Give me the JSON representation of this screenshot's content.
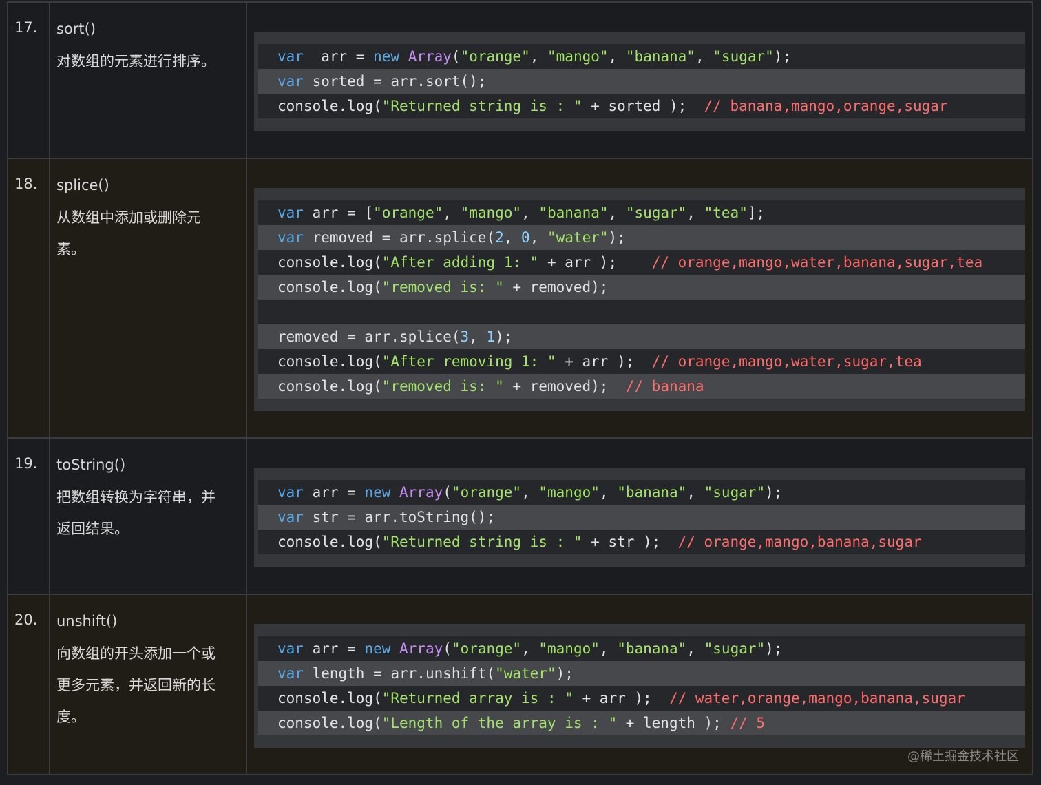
{
  "rows": [
    {
      "num": "17.",
      "method": "sort()",
      "desc": [
        "对数组的元素进行排序。"
      ],
      "code": [
        {
          "style": "dark",
          "tokens": [
            [
              "kw",
              "var"
            ],
            [
              "",
              "  arr = "
            ],
            [
              "kw",
              "new"
            ],
            [
              "",
              " "
            ],
            [
              "cls",
              "Array"
            ],
            [
              "",
              "("
            ],
            [
              "str",
              "\"orange\""
            ],
            [
              "",
              ", "
            ],
            [
              "str",
              "\"mango\""
            ],
            [
              "",
              ", "
            ],
            [
              "str",
              "\"banana\""
            ],
            [
              "",
              ", "
            ],
            [
              "str",
              "\"sugar\""
            ],
            [
              "",
              ");"
            ]
          ]
        },
        {
          "style": "alt",
          "tokens": [
            [
              "kw",
              "var"
            ],
            [
              "",
              " sorted = arr.sort();"
            ]
          ]
        },
        {
          "style": "dark",
          "tokens": [
            [
              "",
              "console.log("
            ],
            [
              "str",
              "\"Returned string is : \""
            ],
            [
              "",
              " + sorted );  "
            ],
            [
              "cm",
              "// banana,mango,orange,sugar"
            ]
          ]
        }
      ]
    },
    {
      "num": "18.",
      "method": "splice()",
      "desc": [
        "从数组中添加或删除元",
        "素。"
      ],
      "code": [
        {
          "style": "dark",
          "tokens": [
            [
              "kw",
              "var"
            ],
            [
              "",
              " arr = ["
            ],
            [
              "str",
              "\"orange\""
            ],
            [
              "",
              ", "
            ],
            [
              "str",
              "\"mango\""
            ],
            [
              "",
              ", "
            ],
            [
              "str",
              "\"banana\""
            ],
            [
              "",
              ", "
            ],
            [
              "str",
              "\"sugar\""
            ],
            [
              "",
              ", "
            ],
            [
              "str",
              "\"tea\""
            ],
            [
              "",
              "];"
            ]
          ]
        },
        {
          "style": "alt",
          "tokens": [
            [
              "kw",
              "var"
            ],
            [
              "",
              " removed = arr.splice("
            ],
            [
              "num",
              "2"
            ],
            [
              "",
              ", "
            ],
            [
              "num",
              "0"
            ],
            [
              "",
              ", "
            ],
            [
              "str",
              "\"water\""
            ],
            [
              "",
              ");"
            ]
          ]
        },
        {
          "style": "dark",
          "tokens": [
            [
              "",
              "console.log("
            ],
            [
              "str",
              "\"After adding 1: \""
            ],
            [
              "",
              " + arr );    "
            ],
            [
              "cm",
              "// orange,mango,water,banana,sugar,tea"
            ]
          ]
        },
        {
          "style": "alt",
          "tokens": [
            [
              "",
              "console.log("
            ],
            [
              "str",
              "\"removed is: \""
            ],
            [
              "",
              " + removed);"
            ]
          ]
        },
        {
          "style": "dark",
          "tokens": [
            [
              "",
              ""
            ]
          ]
        },
        {
          "style": "alt",
          "tokens": [
            [
              "",
              "removed = arr.splice("
            ],
            [
              "num",
              "3"
            ],
            [
              "",
              ", "
            ],
            [
              "num",
              "1"
            ],
            [
              "",
              ");"
            ]
          ]
        },
        {
          "style": "dark",
          "tokens": [
            [
              "",
              "console.log("
            ],
            [
              "str",
              "\"After removing 1: \""
            ],
            [
              "",
              " + arr );  "
            ],
            [
              "cm",
              "// orange,mango,water,sugar,tea"
            ]
          ]
        },
        {
          "style": "alt",
          "tokens": [
            [
              "",
              "console.log("
            ],
            [
              "str",
              "\"removed is: \""
            ],
            [
              "",
              " + removed);  "
            ],
            [
              "cm",
              "// banana"
            ]
          ]
        }
      ]
    },
    {
      "num": "19.",
      "method": "toString()",
      "desc": [
        "把数组转换为字符串，并",
        "返回结果。"
      ],
      "code": [
        {
          "style": "dark",
          "tokens": [
            [
              "kw",
              "var"
            ],
            [
              "",
              " arr = "
            ],
            [
              "kw",
              "new"
            ],
            [
              "",
              " "
            ],
            [
              "cls",
              "Array"
            ],
            [
              "",
              "("
            ],
            [
              "str",
              "\"orange\""
            ],
            [
              "",
              ", "
            ],
            [
              "str",
              "\"mango\""
            ],
            [
              "",
              ", "
            ],
            [
              "str",
              "\"banana\""
            ],
            [
              "",
              ", "
            ],
            [
              "str",
              "\"sugar\""
            ],
            [
              "",
              ");"
            ]
          ]
        },
        {
          "style": "alt",
          "tokens": [
            [
              "kw",
              "var"
            ],
            [
              "",
              " str = arr.toString();"
            ]
          ]
        },
        {
          "style": "dark",
          "tokens": [
            [
              "",
              "console.log("
            ],
            [
              "str",
              "\"Returned string is : \""
            ],
            [
              "",
              " + str );  "
            ],
            [
              "cm",
              "// orange,mango,banana,sugar"
            ]
          ]
        }
      ]
    },
    {
      "num": "20.",
      "method": "unshift()",
      "desc": [
        "向数组的开头添加一个或",
        "更多元素，并返回新的长",
        "度。"
      ],
      "code": [
        {
          "style": "dark",
          "tokens": [
            [
              "kw",
              "var"
            ],
            [
              "",
              " arr = "
            ],
            [
              "kw",
              "new"
            ],
            [
              "",
              " "
            ],
            [
              "cls",
              "Array"
            ],
            [
              "",
              "("
            ],
            [
              "str",
              "\"orange\""
            ],
            [
              "",
              ", "
            ],
            [
              "str",
              "\"mango\""
            ],
            [
              "",
              ", "
            ],
            [
              "str",
              "\"banana\""
            ],
            [
              "",
              ", "
            ],
            [
              "str",
              "\"sugar\""
            ],
            [
              "",
              ");"
            ]
          ]
        },
        {
          "style": "alt",
          "tokens": [
            [
              "kw",
              "var"
            ],
            [
              "",
              " length = arr.unshift("
            ],
            [
              "str",
              "\"water\""
            ],
            [
              "",
              ");"
            ]
          ]
        },
        {
          "style": "dark",
          "tokens": [
            [
              "",
              "console.log("
            ],
            [
              "str",
              "\"Returned array is : \""
            ],
            [
              "",
              " + arr );  "
            ],
            [
              "cm",
              "// water,orange,mango,banana,sugar"
            ]
          ]
        },
        {
          "style": "alt",
          "tokens": [
            [
              "",
              "console.log("
            ],
            [
              "str",
              "\"Length of the array is : \""
            ],
            [
              "",
              " + length ); "
            ],
            [
              "cm",
              "// 5"
            ]
          ]
        }
      ]
    }
  ],
  "watermark": "@稀土掘金技术社区"
}
